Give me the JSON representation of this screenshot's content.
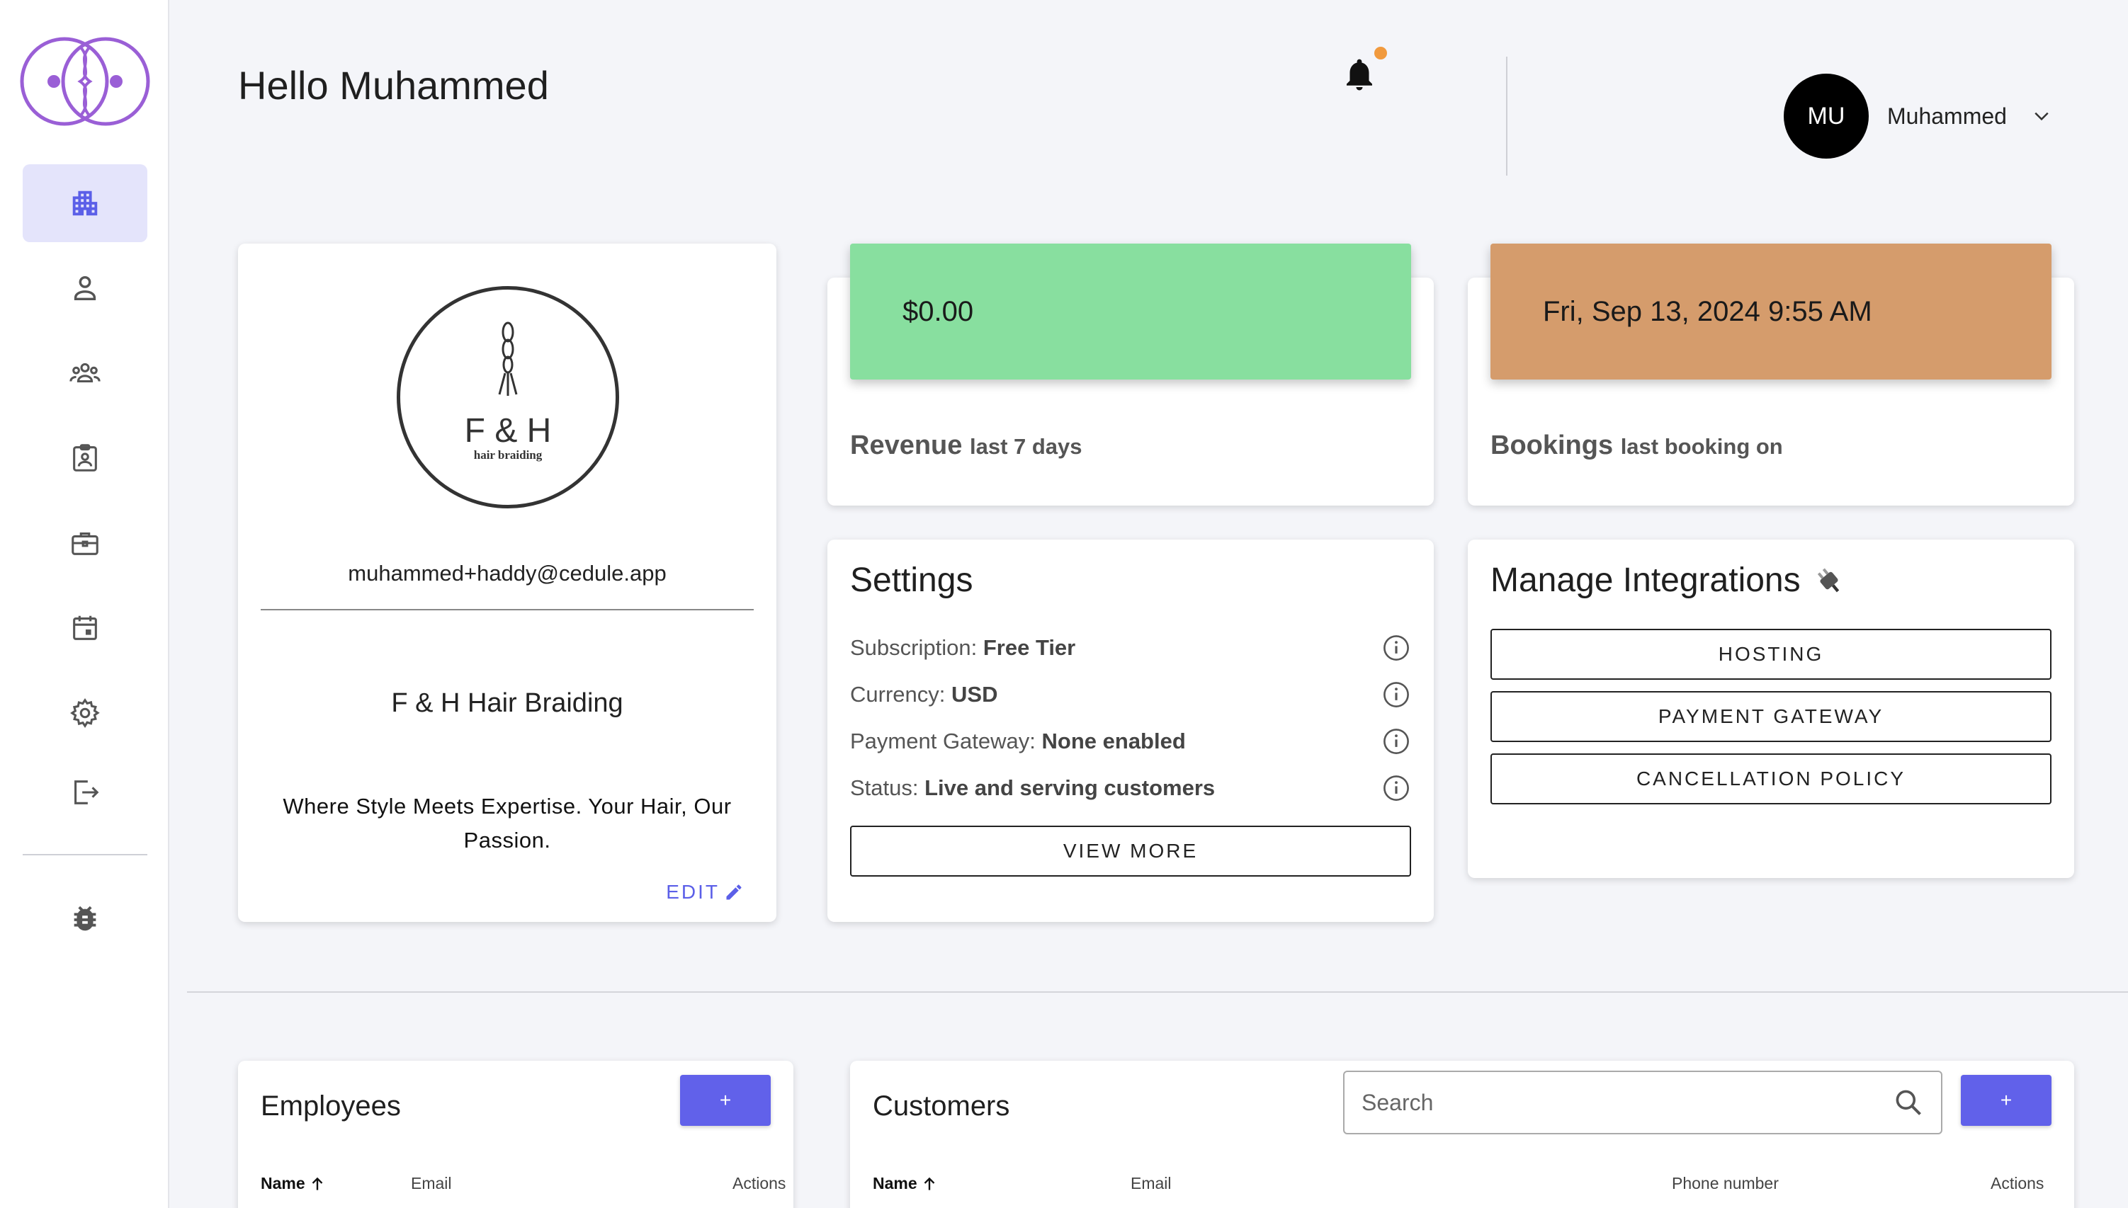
{
  "header": {
    "greeting": "Hello Muhammed",
    "user_initials": "MU",
    "user_name": "Muhammed"
  },
  "sidebar": {
    "items": [
      {
        "icon": "dashboard-icon",
        "active": true
      },
      {
        "icon": "person-icon"
      },
      {
        "icon": "group-icon"
      },
      {
        "icon": "badge-icon"
      },
      {
        "icon": "briefcase-icon"
      },
      {
        "icon": "calendar-icon"
      },
      {
        "icon": "gear-icon"
      },
      {
        "icon": "logout-icon"
      },
      {
        "icon": "bug-icon"
      }
    ]
  },
  "profile": {
    "logo_text": "F & H",
    "logo_subtext": "hair braiding",
    "email": "muhammed+haddy@cedule.app",
    "business_name": "F & H Hair Braiding",
    "tagline": "Where Style Meets Expertise. Your Hair, Our Passion.",
    "edit_label": "EDIT"
  },
  "revenue": {
    "value": "$0.00",
    "label": "Revenue",
    "sublabel": "last 7 days"
  },
  "bookings": {
    "value": "Fri, Sep 13, 2024 9:55 AM",
    "label": "Bookings",
    "sublabel": "last booking on"
  },
  "settings": {
    "title": "Settings",
    "rows": [
      {
        "label": "Subscription:",
        "value": "Free Tier"
      },
      {
        "label": "Currency:",
        "value": "USD"
      },
      {
        "label": "Payment Gateway:",
        "value": "None enabled"
      },
      {
        "label": "Status:",
        "value": "Live and serving customers"
      }
    ],
    "view_more_label": "VIEW MORE"
  },
  "integrations": {
    "title": "Manage Integrations",
    "buttons": [
      "HOSTING",
      "PAYMENT GATEWAY",
      "CANCELLATION POLICY"
    ]
  },
  "employees": {
    "title": "Employees",
    "add_label": "+",
    "columns": [
      "Name",
      "Email",
      "Actions"
    ]
  },
  "customers": {
    "title": "Customers",
    "add_label": "+",
    "search_placeholder": "Search",
    "columns": [
      "Name",
      "Email",
      "Phone number",
      "Actions"
    ]
  },
  "colors": {
    "accent": "#6161ea",
    "revenue_band": "#88df9f",
    "bookings_band": "#d59c6c",
    "notification_dot": "#f19a3e",
    "logo_purple": "#9a5fd6"
  }
}
